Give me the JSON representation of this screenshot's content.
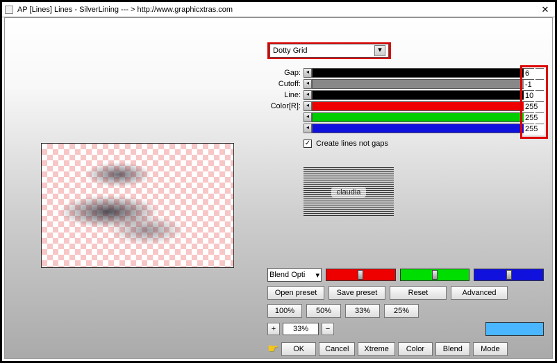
{
  "title": "AP [Lines]  Lines - SilverLining    --- >  http://www.graphicxtras.com",
  "dropdown": {
    "value": "Dotty Grid"
  },
  "params": {
    "labels": {
      "gap": "Gap:",
      "cutoff": "Cutoff:",
      "line": "Line:",
      "color": "Color[R]:"
    },
    "values": {
      "gap": "6",
      "cutoff": "-1",
      "line": "10",
      "r": "255",
      "g": "255",
      "b": "255"
    }
  },
  "checkbox": {
    "label": "Create lines not gaps"
  },
  "logo": "claudia",
  "blend": {
    "label": "Blend Opti"
  },
  "presets": {
    "open": "Open preset",
    "save": "Save preset",
    "reset": "Reset",
    "adv": "Advanced"
  },
  "pct": {
    "p100": "100%",
    "p50": "50%",
    "p33": "33%",
    "p25": "25%"
  },
  "zoom": {
    "plus": "+",
    "val": "33%",
    "minus": "−"
  },
  "actions": {
    "ok": "OK",
    "cancel": "Cancel",
    "xtreme": "Xtreme",
    "color": "Color",
    "blend": "Blend",
    "mode": "Mode"
  }
}
